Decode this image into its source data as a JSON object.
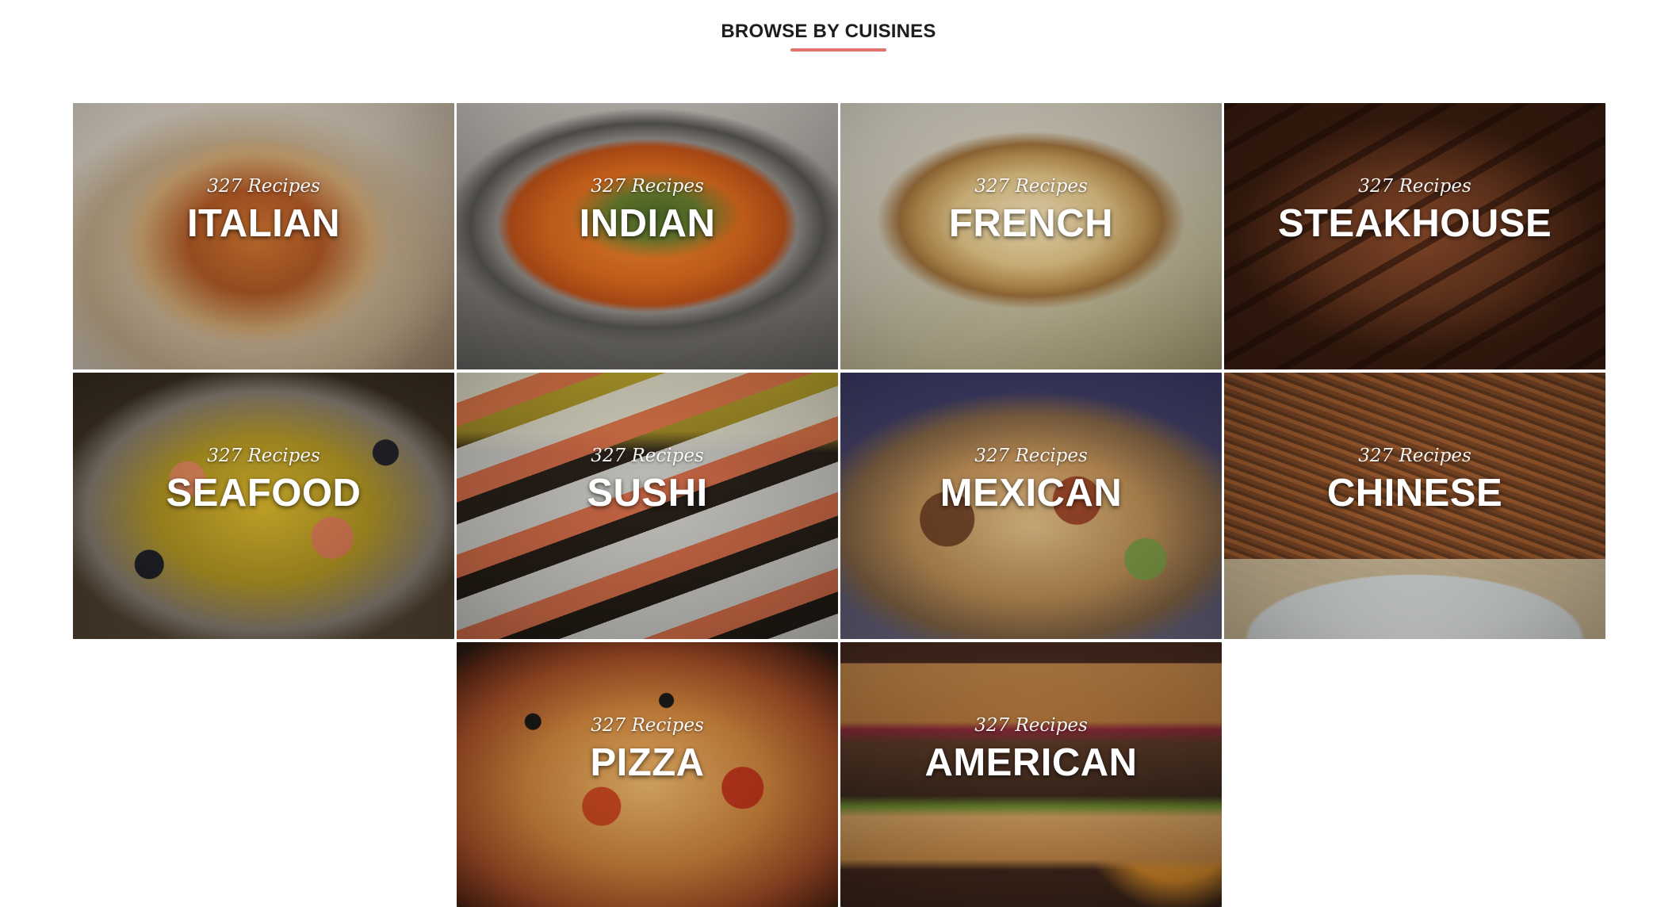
{
  "section": {
    "title": "BROWSE BY CUISINES",
    "accent_color": "#e5726b"
  },
  "cuisines": [
    {
      "name": "ITALIAN",
      "count": "327 Recipes",
      "icon": "pasta-photo",
      "colors": [
        "#efe4d6",
        "#c9b08b",
        "#9a4a2a"
      ]
    },
    {
      "name": "INDIAN",
      "count": "327 Recipes",
      "icon": "curry-photo",
      "colors": [
        "#b9b2aa",
        "#e87a2c",
        "#7b7a77"
      ]
    },
    {
      "name": "FRENCH",
      "count": "327 Recipes",
      "icon": "quiche-photo",
      "colors": [
        "#d9d3c4",
        "#d6a965",
        "#8a6b3a"
      ]
    },
    {
      "name": "STEAKHOUSE",
      "count": "327 Recipes",
      "icon": "steak-photo",
      "colors": [
        "#5a2c1b",
        "#7a3f22",
        "#2a140c"
      ]
    },
    {
      "name": "SEAFOOD",
      "count": "327 Recipes",
      "icon": "paella-photo",
      "colors": [
        "#4a3b25",
        "#c8a126",
        "#e08a5b"
      ]
    },
    {
      "name": "SUSHI",
      "count": "327 Recipes",
      "icon": "sushi-photo",
      "colors": [
        "#b29a2c",
        "#e5795a",
        "#2b2118"
      ]
    },
    {
      "name": "MEXICAN",
      "count": "327 Recipes",
      "icon": "nachos-photo",
      "colors": [
        "#3f3c6a",
        "#d9b07a",
        "#6b4a2c"
      ]
    },
    {
      "name": "CHINESE",
      "count": "327 Recipes",
      "icon": "noodles-photo",
      "colors": [
        "#d9c9a8",
        "#8a4a22",
        "#e9eaea"
      ]
    },
    {
      "name": "PIZZA",
      "count": "327 Recipes",
      "icon": "pizza-photo",
      "colors": [
        "#2a1a12",
        "#d25a2a",
        "#e3b46a"
      ]
    },
    {
      "name": "AMERICAN",
      "count": "327 Recipes",
      "icon": "burger-photo",
      "colors": [
        "#4a2f22",
        "#c98a4a",
        "#3a2418"
      ]
    }
  ]
}
